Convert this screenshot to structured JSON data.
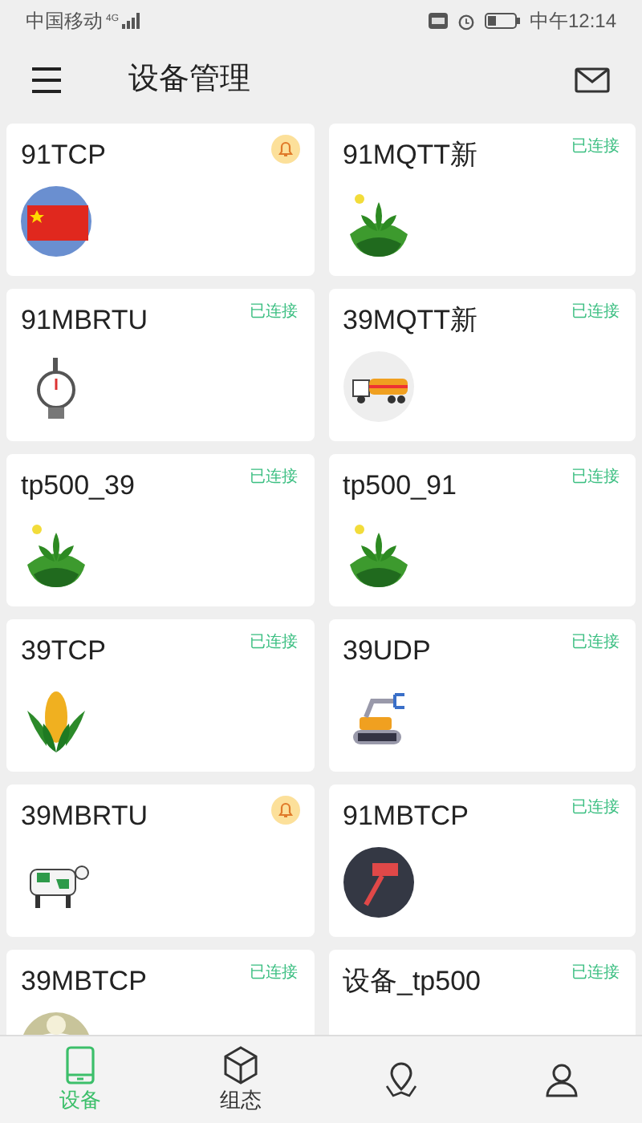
{
  "status_bar": {
    "carrier": "中国移动",
    "network": "4G",
    "time": "中午12:14"
  },
  "header": {
    "title": "设备管理"
  },
  "devices": [
    {
      "name": "91TCP",
      "status": {
        "kind": "alarm"
      }
    },
    {
      "name": "91MQTT新",
      "status": {
        "kind": "connected",
        "label": "已连接"
      }
    },
    {
      "name": "91MBRTU",
      "status": {
        "kind": "connected",
        "label": "已连接"
      }
    },
    {
      "name": "39MQTT新",
      "status": {
        "kind": "connected",
        "label": "已连接"
      }
    },
    {
      "name": "tp500_39",
      "status": {
        "kind": "connected",
        "label": "已连接"
      }
    },
    {
      "name": "tp500_91",
      "status": {
        "kind": "connected",
        "label": "已连接"
      }
    },
    {
      "name": "39TCP",
      "status": {
        "kind": "connected",
        "label": "已连接"
      }
    },
    {
      "name": "39UDP",
      "status": {
        "kind": "connected",
        "label": "已连接"
      }
    },
    {
      "name": "39MBRTU",
      "status": {
        "kind": "alarm"
      }
    },
    {
      "name": "91MBTCP",
      "status": {
        "kind": "connected",
        "label": "已连接"
      }
    },
    {
      "name": "39MBTCP",
      "status": {
        "kind": "connected",
        "label": "已连接"
      }
    },
    {
      "name": "设备_tp500",
      "status": {
        "kind": "connected",
        "label": "已连接"
      }
    }
  ],
  "bottom_nav": [
    {
      "label": "设备",
      "selected": true
    },
    {
      "label": "组态",
      "selected": false
    },
    {
      "selected": false
    },
    {
      "selected": false
    }
  ]
}
